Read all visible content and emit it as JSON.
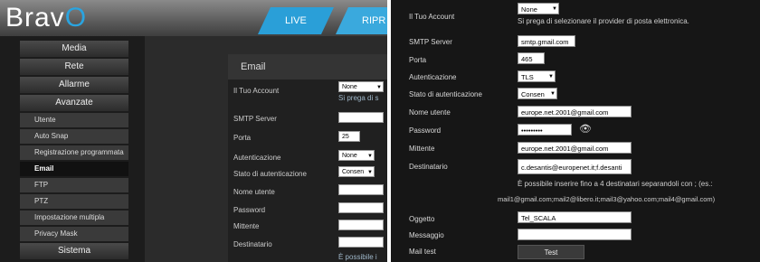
{
  "left": {
    "logo": {
      "text_a": "Brav",
      "text_b": "O"
    },
    "tabs": [
      "LIVE",
      "RIPR"
    ],
    "menu": {
      "media": "Media",
      "rete": "Rete",
      "allarme": "Allarme",
      "avanzate": "Avanzate",
      "sub": [
        "Utente",
        "Auto Snap",
        "Registrazione programmata",
        "Email",
        "FTP",
        "PTZ",
        "Impostazione multipla",
        "Privacy Mask"
      ],
      "sistema": "Sistema"
    },
    "email_box": {
      "title": "Email",
      "tuo_account": "Il Tuo Account",
      "account_value": "None",
      "account_hint": "Si prega di s",
      "smtp": "SMTP Server",
      "porta": "Porta",
      "porta_value": "25",
      "autenticazione": "Autenticazione",
      "auth_value": "None",
      "stato": "Stato di autenticazione",
      "stato_value": "Consen",
      "nome": "Nome utente",
      "password": "Password",
      "mittente": "Mittente",
      "destinatario": "Destinatario",
      "possibile": "È possibile i"
    }
  },
  "right": {
    "account_value": "None",
    "tuo_account": "Il Tuo Account",
    "account_hint": "Si prega di selezionare il provider di posta elettronica.",
    "smtp_label": "SMTP Server",
    "smtp_value": "smtp.gmail.com",
    "porta_label": "Porta",
    "porta_value": "465",
    "auth_label": "Autenticazione",
    "auth_value": "TLS",
    "stato_label": "Stato di autenticazione",
    "stato_value": "Consen",
    "nome_label": "Nome utente",
    "nome_value": "europe.net.2001@gmail.com",
    "password_label": "Password",
    "password_value": "•••••••••",
    "mittente_label": "Mittente",
    "mittente_value": "europe.net.2001@gmail.com",
    "destinatario_label": "Destinatario",
    "destinatario_value": "c.desantis@europenet.it;f.desanti",
    "dest_hint1": "È possibile inserire fino a 4 destinatari separandoli con ; (es.:",
    "dest_hint2": "mail1@gmail.com;mail2@libero.it;mail3@yahoo.com;mail4@gmail.com)",
    "oggetto_label": "Oggetto",
    "oggetto_value": "Tel_SCALA",
    "messaggio_label": "Messaggio",
    "messaggio_value": "",
    "mailtest_label": "Mail test",
    "test_button": "Test"
  }
}
